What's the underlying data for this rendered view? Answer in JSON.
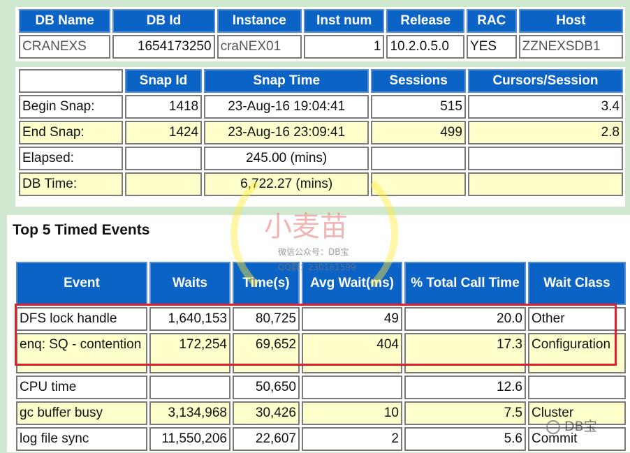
{
  "db_info": {
    "headers": [
      "DB Name",
      "DB Id",
      "Instance",
      "Inst num",
      "Release",
      "RAC",
      "Host"
    ],
    "row": [
      "CRANEXS",
      "1654173250",
      "craNEX01",
      "1",
      "10.2.0.5.0",
      "YES",
      "ZZNEXSDB1"
    ]
  },
  "snap_info": {
    "headers": [
      "",
      "Snap Id",
      "Snap Time",
      "Sessions",
      "Cursors/Session"
    ],
    "rows": [
      [
        "Begin Snap:",
        "1418",
        "23-Aug-16 19:04:41",
        "515",
        "3.4"
      ],
      [
        "End Snap:",
        "1424",
        "23-Aug-16 23:09:41",
        "499",
        "2.8"
      ],
      [
        "Elapsed:",
        "",
        "245.00 (mins)",
        "",
        ""
      ],
      [
        "DB Time:",
        "",
        "6,722.27 (mins)",
        "",
        ""
      ]
    ]
  },
  "top_events": {
    "title": "Top 5 Timed Events",
    "headers": [
      "Event",
      "Waits",
      "Time(s)",
      "Avg Wait(ms)",
      "% Total Call Time",
      "Wait Class"
    ],
    "rows": [
      [
        "DFS lock handle",
        "1,640,153",
        "80,725",
        "49",
        "20.0",
        "Other"
      ],
      [
        "enq: SQ - contention",
        "172,254",
        "69,652",
        "404",
        "17.3",
        "Configuration"
      ],
      [
        "CPU time",
        "",
        "50,650",
        "",
        "12.6",
        ""
      ],
      [
        "gc buffer busy",
        "3,134,968",
        "30,426",
        "10",
        "7.5",
        "Cluster"
      ],
      [
        "log file sync",
        "11,550,206",
        "22,607",
        "2",
        "5.6",
        "Commit"
      ]
    ]
  },
  "watermark": {
    "name": "小麦苗",
    "wechat": "微信公众号：DB宝",
    "qq": "QQ群：230161599",
    "badge": "DB宝"
  },
  "colors": {
    "header_bg": "#0b63c5",
    "alt_row_bg": "#ffffcc",
    "page_bg": "#cfe8cf",
    "highlight_border": "#e0202a"
  }
}
